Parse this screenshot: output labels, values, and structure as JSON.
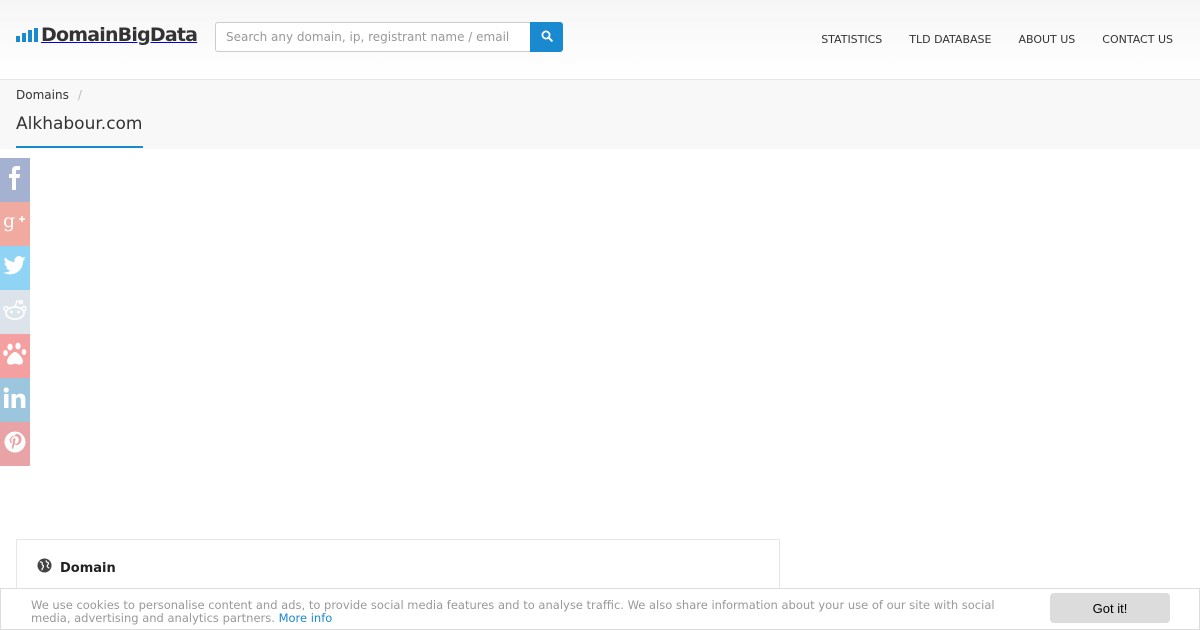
{
  "header": {
    "logo_text": "DomainBigData",
    "logo_bar_color": "#1a8ad0",
    "search": {
      "placeholder": "Search any domain, ip, registrant name / email",
      "value": "",
      "button_icon": "search-icon"
    },
    "nav": [
      {
        "label": "STATISTICS"
      },
      {
        "label": "TLD DATABASE"
      },
      {
        "label": "ABOUT US"
      },
      {
        "label": "CONTACT US"
      }
    ]
  },
  "breadcrumb": {
    "items": [
      "Domains"
    ],
    "separator": "/"
  },
  "page_title": "Alkhabour.com",
  "share": [
    {
      "icon": "facebook-icon",
      "color": "#a4b1d0"
    },
    {
      "icon": "google-plus-icon",
      "color": "#f1aaa0"
    },
    {
      "icon": "twitter-icon",
      "color": "#8fd4f5"
    },
    {
      "icon": "reddit-icon",
      "color": "#dde3ea"
    },
    {
      "icon": "paw-icon",
      "color": "#f5a0a0"
    },
    {
      "icon": "linkedin-icon",
      "color": "#9bc6dd"
    },
    {
      "icon": "pinterest-icon",
      "color": "#e9a3a6"
    }
  ],
  "domain_card": {
    "icon": "globe-icon",
    "title": "Domain"
  },
  "cookie": {
    "text": "We use cookies to personalise content and ads, to provide social media features and to analyse traffic. We also share information about your use of our site with social media, advertising and analytics partners.",
    "link_label": "More info",
    "button_label": "Got it!"
  }
}
